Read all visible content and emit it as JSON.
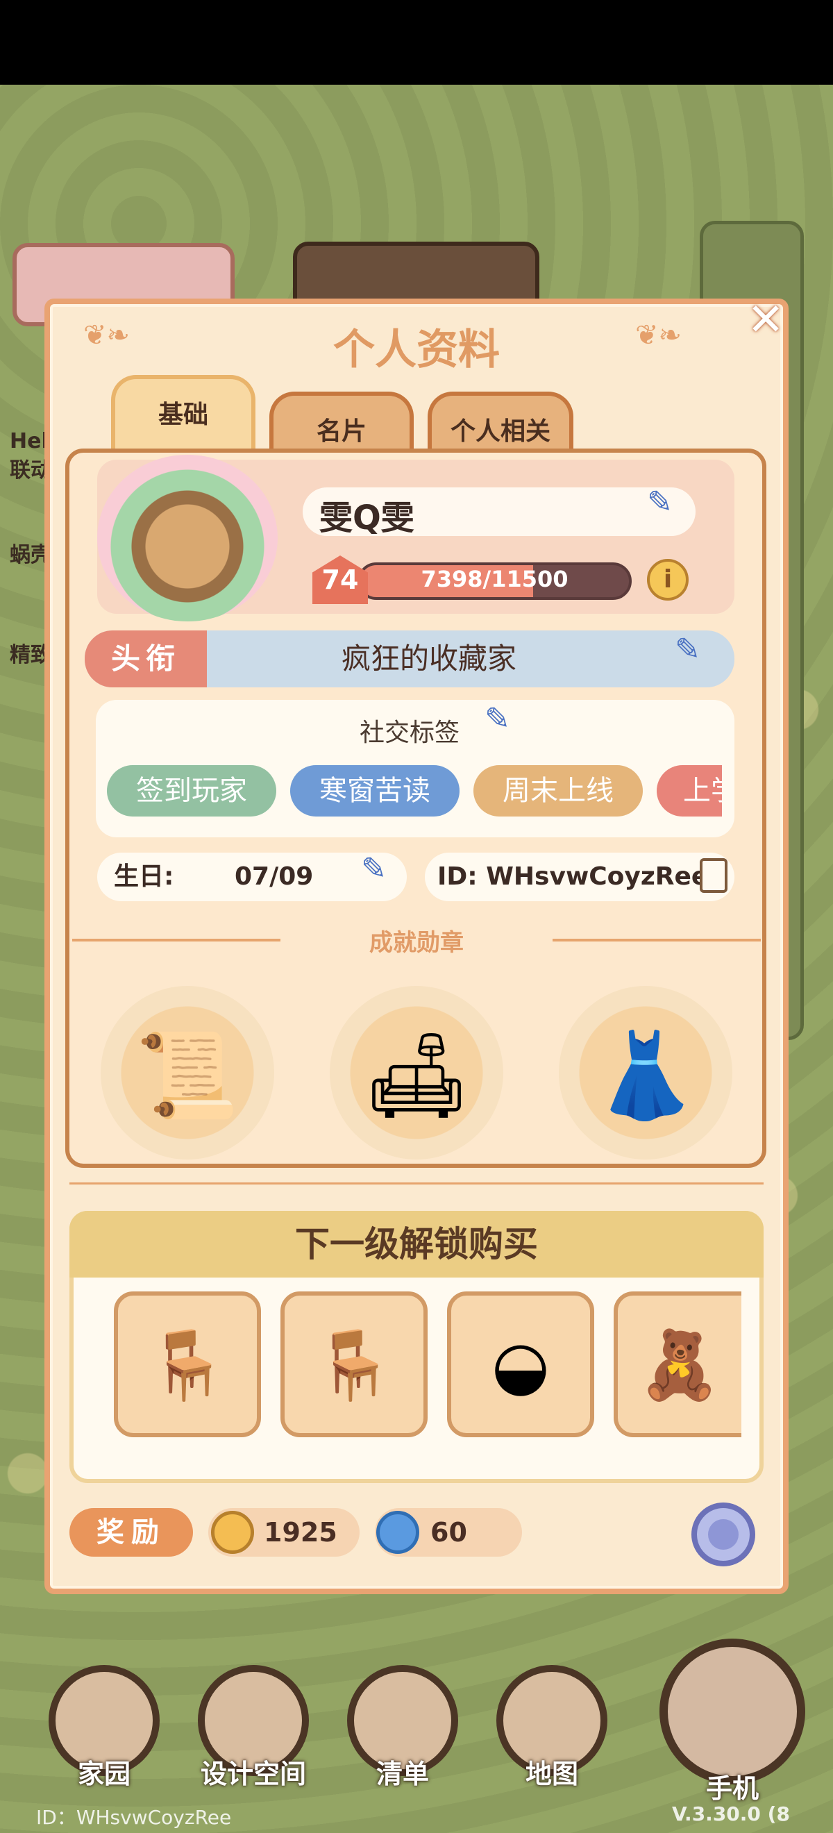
{
  "background": {
    "side_labels": [
      "Hel",
      "联动",
      "蜗壳",
      "精致"
    ]
  },
  "dialog": {
    "title": "个人资料",
    "close_label": "✕"
  },
  "tabs": [
    {
      "label": "基础",
      "active": true
    },
    {
      "label": "名片",
      "active": false
    },
    {
      "label": "个人相关",
      "active": false
    }
  ],
  "profile": {
    "name": "雯Q雯",
    "level": "74",
    "xp_text": "7398/11500",
    "xp_fraction": 0.643,
    "info_label": "i",
    "title_tag": "头衔",
    "title_value": "疯狂的收藏家",
    "social_label": "社交标签",
    "social_tags": [
      {
        "label": "签到玩家",
        "color": "#93c1a2"
      },
      {
        "label": "寒窗苦读",
        "color": "#6f9bd6"
      },
      {
        "label": "周末上线",
        "color": "#e5b57a"
      },
      {
        "label": "上学",
        "color": "#e8847a"
      }
    ],
    "birthday_label": "生日:",
    "birthday_value": "07/09",
    "id_text": "ID: WHsvwCoyzRee"
  },
  "achievements": {
    "title": "成就勋章",
    "medals": [
      {
        "icon": "scroll-box-icon",
        "glyph": "📜"
      },
      {
        "icon": "armchair-icon",
        "glyph": "🛋"
      },
      {
        "icon": "dress-icon",
        "glyph": "👗"
      }
    ]
  },
  "unlock": {
    "title": "下一级解锁购买",
    "items": [
      {
        "icon": "chair-icon",
        "glyph": "🪑"
      },
      {
        "icon": "chair-icon",
        "glyph": "🪑"
      },
      {
        "icon": "round-table-icon",
        "glyph": "◒"
      },
      {
        "icon": "bear-bag-icon",
        "glyph": "🧸"
      }
    ]
  },
  "reward": {
    "label": "奖励",
    "coins": "1925",
    "gems": "60"
  },
  "nav": {
    "items": [
      {
        "label": "家园",
        "icon": "house-icon"
      },
      {
        "label": "设计空间",
        "icon": "design-icon"
      },
      {
        "label": "清单",
        "icon": "list-icon"
      },
      {
        "label": "地图",
        "icon": "map-pin-icon"
      }
    ],
    "phone_label": "手机"
  },
  "footer": {
    "id_text": "ID：WHsvwCoyzRee",
    "version": "V.3.30.0 (8"
  },
  "colors": {
    "accent": "#e09a63",
    "panel_border": "#c6834b",
    "xp_fill": "#ec8671"
  }
}
